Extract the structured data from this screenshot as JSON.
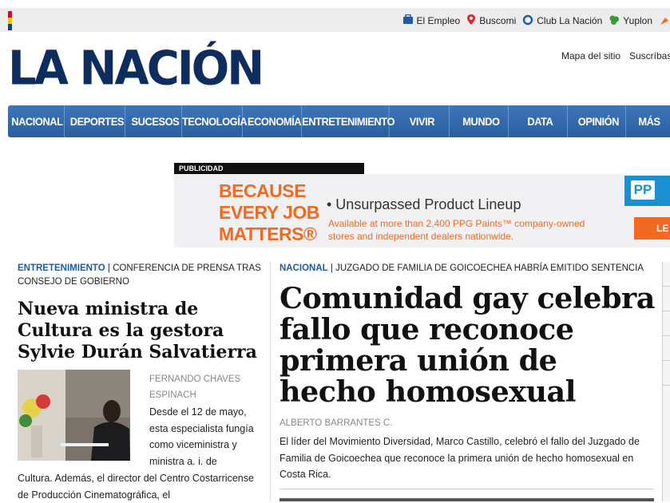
{
  "toplinks": [
    {
      "label": "El Empleo",
      "icon": "briefcase-icon",
      "color": "#1f5aa5"
    },
    {
      "label": "Buscomi",
      "icon": "location-pin-icon",
      "color": "#d9282f"
    },
    {
      "label": "Club La Nación",
      "icon": "club-ring-icon",
      "color": "#1f5aa5"
    },
    {
      "label": "Yuplon",
      "icon": "clover-icon",
      "color": "#3c9a35"
    }
  ],
  "logo": "LA NACIÓN",
  "utility": {
    "map": "Mapa del sitio",
    "subscribe": "Suscríbase"
  },
  "nav": [
    "NACIONAL",
    "DEPORTES",
    "SUCESOS",
    "TECNOLOGÍA",
    "ECONOMÍA",
    "ENTRETENIMIENTO",
    "VIVIR",
    "MUNDO",
    "DATA",
    "OPINIÓN",
    "MÁS"
  ],
  "ad": {
    "label": "PUBLICIDAD",
    "line1": "BECAUSE",
    "line2": "EVERY JOB",
    "line3": "MATTERS®",
    "lineup": "• Unsurpassed Product Lineup",
    "sub1": "Available at more than 2,400 PPG Paints™ company-owned",
    "sub2": "stores and independent dealers nationwide.",
    "logo": "PP",
    "button": "LE"
  },
  "left": {
    "section": "ENTRETENIMIENTO",
    "kicker": " | CONFERENCIA DE PRENSA TRAS CONSEJO DE GOBIERNO",
    "headline": "Nueva ministra de Cultura es la gestora Sylvie Durán Salvatierra",
    "author": "FERNANDO CHAVES ESPINACH",
    "body": "Desde el 12 de mayo, esta especialista fungía como viceministra y ministra a. i. de",
    "body_cont": "Cultura. Además, el director del Centro Costarricense de Producción Cinematográfica, el"
  },
  "right": {
    "section": "NACIONAL",
    "kicker": " | JUZGADO DE FAMILIA DE GOICOECHEA HABRÍA EMITIDO SENTENCIA",
    "headline": "Comunidad gay celebra fallo que reconoce primera unión de hecho homosexual",
    "author": "ALBERTO BARRANTES C.",
    "lead": "El líder del Movimiento Diversidad, Marco Castillo, celebró el fallo del Juzgado de Familia de Goicoechea que reconoce la primera unión de hecho homosexual en Costa Rica."
  }
}
